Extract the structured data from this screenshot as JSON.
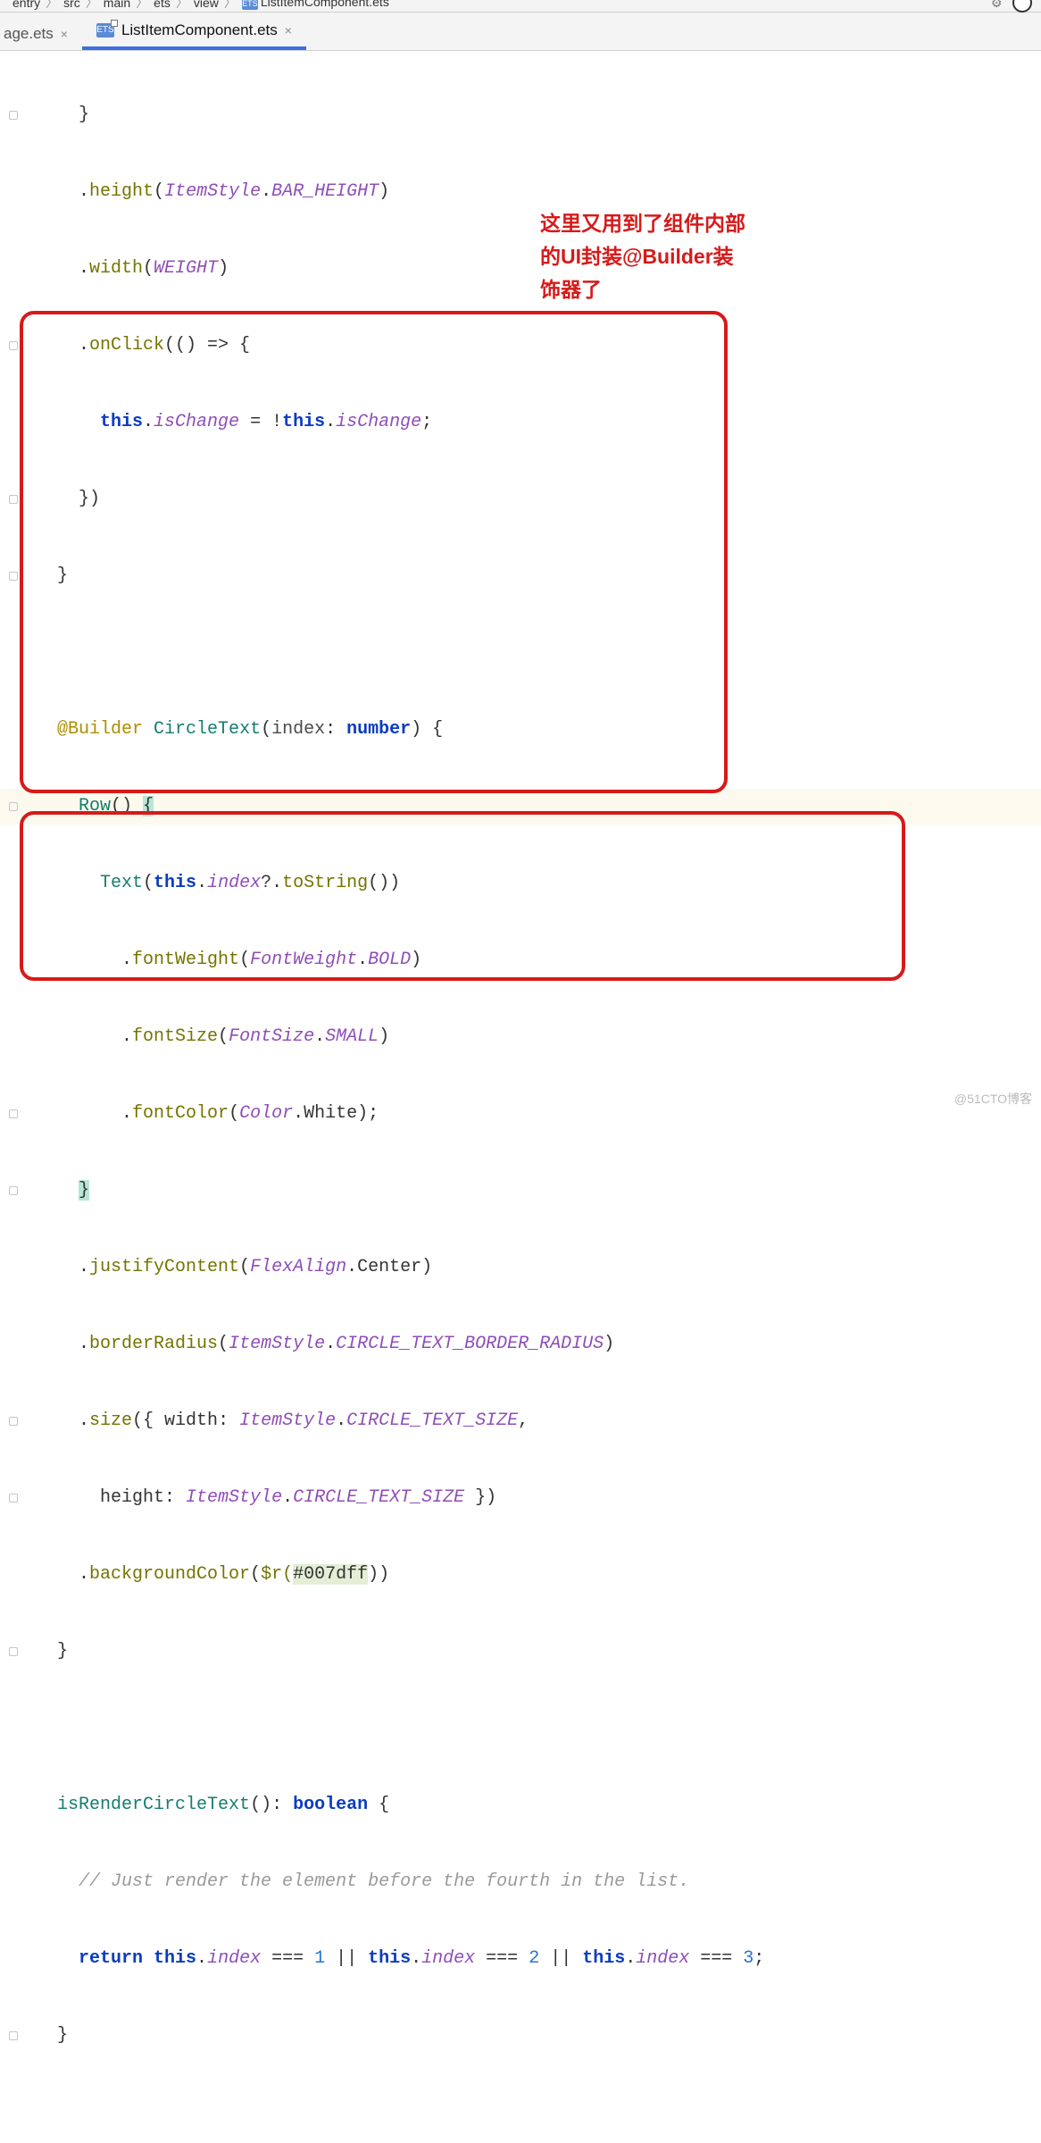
{
  "breadcrumbs": [
    "entry",
    "src",
    "main",
    "ets",
    "view",
    "ListItemComponent.ets"
  ],
  "tabs": {
    "t0": {
      "label": "age.ets"
    },
    "t1": {
      "label": "ListItemComponent.ets"
    }
  },
  "callout": {
    "l1": "这里又用到了组件内部",
    "l2": "的UI封装@Builder装",
    "l3": "饰器了"
  },
  "code": {
    "l1_brace": "}",
    "l2": {
      "dot": ".",
      "m": "height",
      "lp": "(",
      "a": "ItemStyle",
      "dot2": ".",
      "b": "BAR_HEIGHT",
      "rp": ")"
    },
    "l3": {
      "dot": ".",
      "m": "width",
      "lp": "(",
      "a": "WEIGHT",
      "rp": ")"
    },
    "l4": {
      "dot": ".",
      "m": "onClick",
      "lp": "(() => {",
      "rp": ""
    },
    "l5": {
      "kw": "this",
      "dot": ".",
      "p": "isChange",
      "eq": " = !",
      "kw2": "this",
      "dot2": ".",
      "p2": "isChange",
      "semi": ";"
    },
    "l6": "})",
    "l7": "}",
    "blank1": "",
    "l8": {
      "ann": "@Builder",
      "sp": " ",
      "fn": "CircleText",
      "lp": "(",
      "pn": "index",
      "col": ": ",
      "ty": "number",
      "rp": ") {"
    },
    "l9": {
      "fn": "Row",
      "call": "() ",
      "brace": "{"
    },
    "l10": {
      "fn": "Text",
      "lp": "(",
      "kw": "this",
      "dot": ".",
      "p": "index",
      "q": "?.",
      "m": "toString",
      "rp": "())"
    },
    "l11": {
      "dot": ".",
      "m": "fontWeight",
      "lp": "(",
      "a": "FontWeight",
      "dot2": ".",
      "b": "BOLD",
      "rp": ")"
    },
    "l12": {
      "dot": ".",
      "m": "fontSize",
      "lp": "(",
      "a": "FontSize",
      "dot2": ".",
      "b": "SMALL",
      "rp": ")"
    },
    "l13": {
      "dot": ".",
      "m": "fontColor",
      "lp": "(",
      "a": "Color",
      "dot2": ".",
      "b": "White",
      "rp": ");"
    },
    "l14": {
      "brace": "}"
    },
    "l15": {
      "dot": ".",
      "m": "justifyContent",
      "lp": "(",
      "a": "FlexAlign",
      "dot2": ".",
      "b": "Center",
      "rp": ")"
    },
    "l16": {
      "dot": ".",
      "m": "borderRadius",
      "lp": "(",
      "a": "ItemStyle",
      "dot2": ".",
      "b": "CIRCLE_TEXT_BORDER_RADIUS",
      "rp": ")"
    },
    "l17": {
      "dot": ".",
      "m": "size",
      "lp": "({ ",
      "k1": "width",
      "c1": ": ",
      "a": "ItemStyle",
      "dot2": ".",
      "b": "CIRCLE_TEXT_SIZE",
      "comma": ","
    },
    "l18": {
      "k1": "height",
      "c1": ": ",
      "a": "ItemStyle",
      "dot2": ".",
      "b": "CIRCLE_TEXT_SIZE",
      "rp": " })"
    },
    "l19": {
      "dot": ".",
      "m": "backgroundColor",
      "lp": "(",
      "dr": "$r(",
      "hex": "#007dff",
      "rp": "))"
    },
    "l20": "}",
    "blank2": "",
    "l21": {
      "fn": "isRenderCircleText",
      "call": "()",
      "col": ": ",
      "ty": "boolean",
      "brace": " {"
    },
    "l22": "// Just render the element before the fourth in the list.",
    "l23": {
      "kw": "return ",
      "t1": "this",
      "d1": ".",
      "p1": "index",
      "eq1": " === ",
      "n1": "1",
      "or1": " || ",
      "t2": "this",
      "d2": ".",
      "p2": "index",
      "eq2": " === ",
      "n2": "2",
      "or2": " || ",
      "t3": "this",
      "d3": ".",
      "p3": "index",
      "eq3": " === ",
      "n3": "3",
      "semi": ";"
    },
    "l24": "}"
  },
  "watermark": "@51CTO博客"
}
